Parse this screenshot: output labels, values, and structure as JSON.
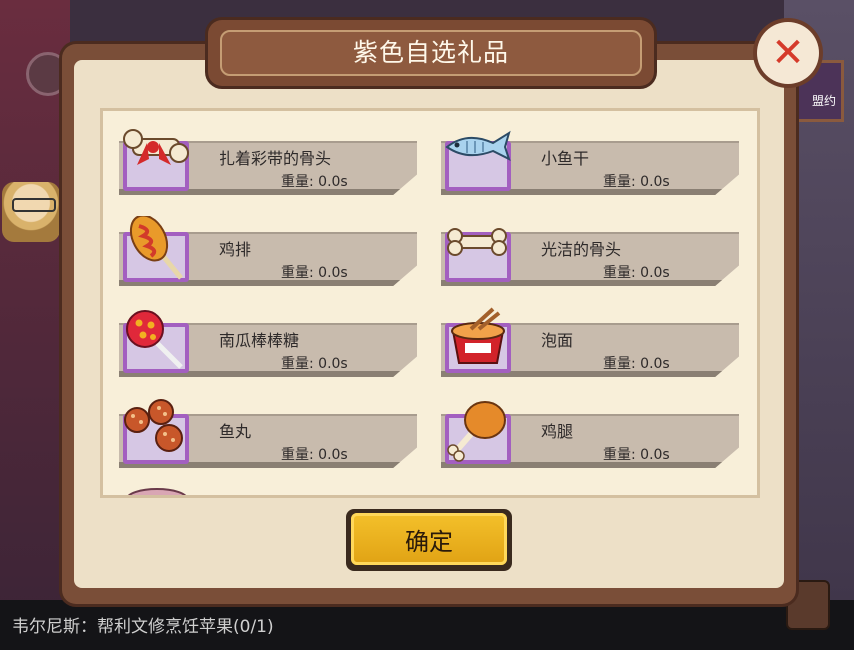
{
  "dialog": {
    "title": "紫色自选礼品",
    "close_symbol": "✕",
    "confirm_label": "确定"
  },
  "items": [
    {
      "name": "扎着彩带的骨头",
      "weight_label": "重量:",
      "weight_value": "0.0s",
      "icon": "ribbon-bone-icon"
    },
    {
      "name": "小鱼干",
      "weight_label": "重量:",
      "weight_value": "0.0s",
      "icon": "dried-fish-icon"
    },
    {
      "name": "鸡排",
      "weight_label": "重量:",
      "weight_value": "0.0s",
      "icon": "chicken-cutlet-icon"
    },
    {
      "name": "光洁的骨头",
      "weight_label": "重量:",
      "weight_value": "0.0s",
      "icon": "clean-bone-icon"
    },
    {
      "name": "南瓜棒棒糖",
      "weight_label": "重量:",
      "weight_value": "0.0s",
      "icon": "pumpkin-lollipop-icon"
    },
    {
      "name": "泡面",
      "weight_label": "重量:",
      "weight_value": "0.0s",
      "icon": "instant-noodle-icon"
    },
    {
      "name": "鱼丸",
      "weight_label": "重量:",
      "weight_value": "0.0s",
      "icon": "fish-ball-icon"
    },
    {
      "name": "鸡腿",
      "weight_label": "重量:",
      "weight_value": "0.0s",
      "icon": "chicken-leg-icon"
    }
  ],
  "background": {
    "quest_text": "韦尔尼斯：帮利文修烹饪苹果(0/1)",
    "right_badge_text": "盟约"
  },
  "colors": {
    "item_frame_purple": "#a35fc0",
    "confirm_gold": "#f4c12b",
    "close_red": "#d53a2a"
  }
}
